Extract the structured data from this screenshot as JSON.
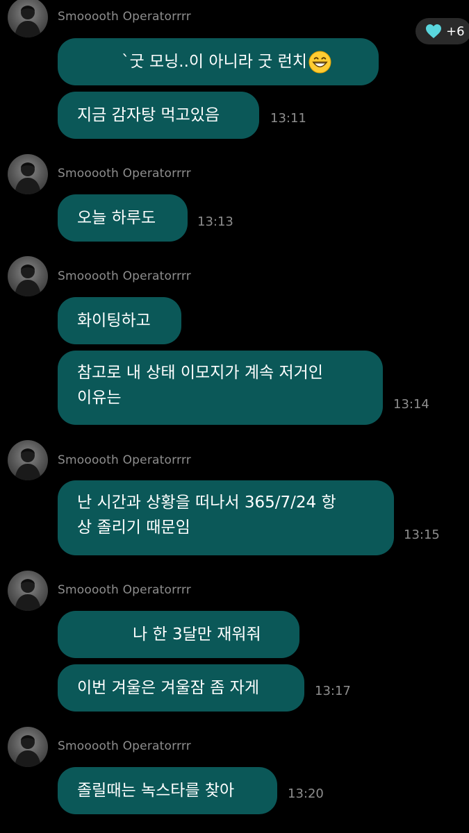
{
  "reaction": {
    "icon": "heart-icon",
    "color": "#5ad6dd",
    "count": "+6"
  },
  "groups": [
    {
      "sender": "Smooooth Operatorrrr",
      "messages": [
        {
          "text": "`굿 모닝..이 아니라 굿 런치",
          "emoji": "grinning-face-icon"
        },
        {
          "text": "지금 감자탕 먹고있음"
        }
      ],
      "time": "13:11"
    },
    {
      "sender": "Smooooth Operatorrrr",
      "messages": [
        {
          "text": "오늘 하루도"
        }
      ],
      "time": "13:13"
    },
    {
      "sender": "Smooooth Operatorrrr",
      "messages": [
        {
          "text": "화이팅하고"
        },
        {
          "lines": [
            "참고로 내 상태 이모지가 계속 저거인",
            "이유는"
          ]
        }
      ],
      "time": "13:14"
    },
    {
      "sender": "Smooooth Operatorrrr",
      "messages": [
        {
          "lines": [
            "난 시간과 상황을 떠나서 365/7/24 항",
            "상 졸리기 때문임"
          ]
        }
      ],
      "time": "13:15"
    },
    {
      "sender": "Smooooth Operatorrrr",
      "messages": [
        {
          "text": "나 한 3달만 재워줘"
        },
        {
          "text": "이번 겨울은 겨울잠 좀 자게"
        }
      ],
      "time": "13:17"
    },
    {
      "sender": "Smooooth Operatorrrr",
      "messages": [
        {
          "text": "졸릴때는 녹스타를 찾아"
        }
      ],
      "time": "13:20"
    }
  ],
  "colors": {
    "bubble": "#0b5858",
    "background": "#000000",
    "meta_text": "#8e8e8e"
  }
}
